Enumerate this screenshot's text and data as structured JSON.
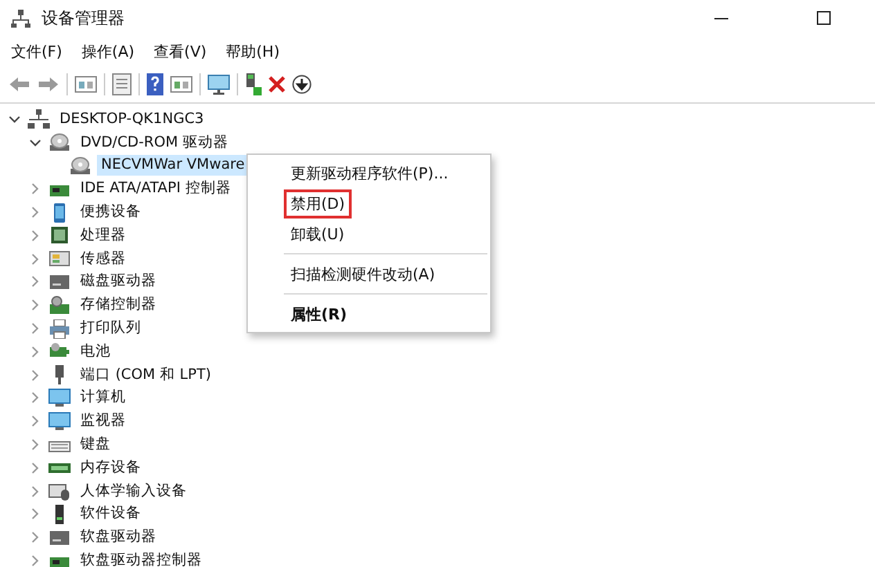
{
  "window": {
    "title": "设备管理器"
  },
  "menu": [
    {
      "label": "文件(F)"
    },
    {
      "label": "操作(A)"
    },
    {
      "label": "查看(V)"
    },
    {
      "label": "帮助(H)"
    }
  ],
  "tree": [
    {
      "label": "DESKTOP-QK1NGC3",
      "kind": "computer",
      "expanded": true,
      "selected": false,
      "children": [
        {
          "label": "DVD/CD-ROM 驱动器",
          "kind": "disc",
          "expanded": true,
          "selected": false,
          "children": [
            {
              "label": "NECVMWar VMware",
              "kind": "disc",
              "selected": true
            }
          ]
        },
        {
          "label": "IDE ATA/ATAPI 控制器",
          "kind": "card",
          "expanded": false,
          "selected": false
        },
        {
          "label": "便携设备",
          "kind": "portable",
          "expanded": false,
          "selected": false
        },
        {
          "label": "处理器",
          "kind": "cpu",
          "expanded": false,
          "selected": false
        },
        {
          "label": "传感器",
          "kind": "sensor",
          "expanded": false,
          "selected": false
        },
        {
          "label": "磁盘驱动器",
          "kind": "disk",
          "expanded": false,
          "selected": false
        },
        {
          "label": "存储控制器",
          "kind": "storage",
          "expanded": false,
          "selected": false
        },
        {
          "label": "打印队列",
          "kind": "printer",
          "expanded": false,
          "selected": false
        },
        {
          "label": "电池",
          "kind": "battery",
          "expanded": false,
          "selected": false
        },
        {
          "label": "端口 (COM 和 LPT)",
          "kind": "port",
          "expanded": false,
          "selected": false
        },
        {
          "label": "计算机",
          "kind": "monitor",
          "expanded": false,
          "selected": false
        },
        {
          "label": "监视器",
          "kind": "monitor",
          "expanded": false,
          "selected": false
        },
        {
          "label": "键盘",
          "kind": "keyboard",
          "expanded": false,
          "selected": false
        },
        {
          "label": "内存设备",
          "kind": "memory",
          "expanded": false,
          "selected": false
        },
        {
          "label": "人体学输入设备",
          "kind": "hid",
          "expanded": false,
          "selected": false
        },
        {
          "label": "软件设备",
          "kind": "software",
          "expanded": false,
          "selected": false
        },
        {
          "label": "软盘驱动器",
          "kind": "disk",
          "expanded": false,
          "selected": false
        },
        {
          "label": "软盘驱动器控制器",
          "kind": "card",
          "expanded": false,
          "selected": false
        }
      ]
    }
  ],
  "context_menu": [
    {
      "label": "更新驱动程序软件(P)...",
      "separator_before": false,
      "highlighted": false,
      "default": false
    },
    {
      "label": "禁用(D)",
      "separator_before": false,
      "highlighted": true,
      "default": false
    },
    {
      "label": "卸载(U)",
      "separator_before": false,
      "highlighted": false,
      "default": false
    },
    {
      "label": "扫描检测硬件改动(A)",
      "separator_before": true,
      "highlighted": false,
      "default": false
    },
    {
      "label": "属性(R)",
      "separator_before": true,
      "highlighted": false,
      "default": true
    }
  ]
}
